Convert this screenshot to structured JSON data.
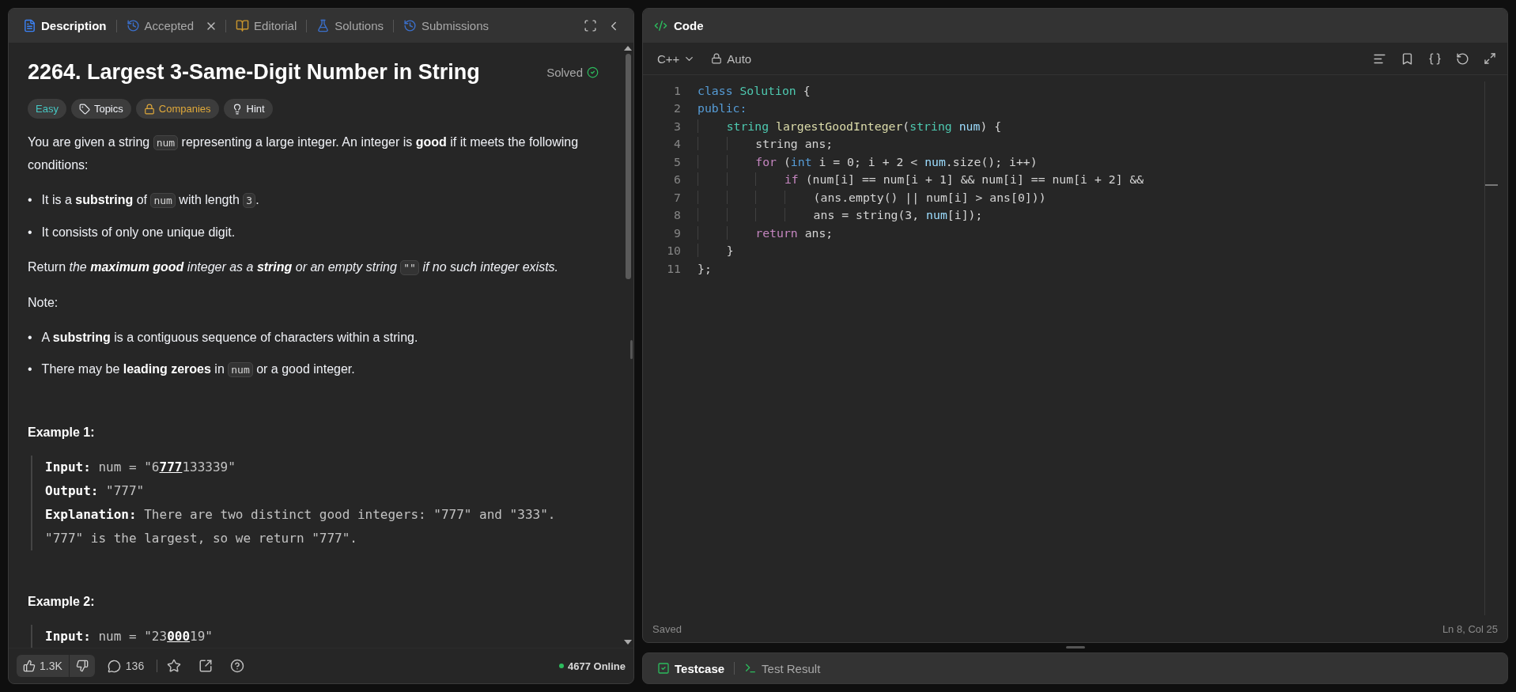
{
  "problem_panel": {
    "tabs": [
      {
        "label": "Description",
        "kind": "description",
        "selected": true,
        "closable": false
      },
      {
        "label": "Accepted",
        "kind": "history",
        "selected": false,
        "closable": true
      },
      {
        "label": "Editorial",
        "kind": "book",
        "selected": false,
        "closable": false
      },
      {
        "label": "Solutions",
        "kind": "flask",
        "selected": false,
        "closable": false
      },
      {
        "label": "Submissions",
        "kind": "history",
        "selected": false,
        "closable": false
      }
    ],
    "title": "2264. Largest 3-Same-Digit Number in String",
    "status": "Solved",
    "tags": [
      {
        "label": "Easy",
        "kind": "difficulty"
      },
      {
        "label": "Topics",
        "kind": "topics"
      },
      {
        "label": "Companies",
        "kind": "companies"
      },
      {
        "label": "Hint",
        "kind": "hint"
      }
    ],
    "content": [
      {
        "kind": "paragraph",
        "segments": [
          {
            "kind": "text",
            "text": "You are given a string "
          },
          {
            "kind": "code",
            "text": "num"
          },
          {
            "kind": "text",
            "text": " representing a large integer. An integer is **good** if it meets the following conditions:"
          }
        ]
      },
      {
        "kind": "bullets",
        "items": [
          {
            "marker": "•",
            "segments": [
              {
                "kind": "text",
                "text": "It is a **substring** of "
              },
              {
                "kind": "code",
                "text": "num"
              },
              {
                "kind": "text",
                "text": " with length "
              },
              {
                "kind": "code",
                "text": "3"
              },
              {
                "kind": "text",
                "text": "."
              }
            ]
          },
          {
            "marker": "•",
            "segments": [
              {
                "kind": "text",
                "text": "It consists of only one unique digit."
              }
            ]
          }
        ]
      },
      {
        "kind": "paragraph",
        "segments": [
          {
            "kind": "text",
            "text": "Return "
          },
          {
            "kind": "em",
            "text": "the **maximum good** integer as a **string** or an empty string "
          },
          {
            "kind": "code",
            "text": "\"\""
          },
          {
            "kind": "em",
            "text": " if no such integer exists."
          }
        ]
      },
      {
        "kind": "paragraph",
        "segments": [
          {
            "kind": "text",
            "text": "Note:"
          }
        ]
      },
      {
        "kind": "bullets",
        "items": [
          {
            "marker": "•",
            "segments": [
              {
                "kind": "text",
                "text": "A **substring** is a contiguous sequence of characters within a string."
              }
            ]
          },
          {
            "marker": "•",
            "segments": [
              {
                "kind": "text",
                "text": "There may be **leading zeroes** in "
              },
              {
                "kind": "code",
                "text": "num"
              },
              {
                "kind": "text",
                "text": " or a good integer."
              }
            ]
          }
        ]
      },
      {
        "kind": "example",
        "heading": "Example 1:",
        "lines": [
          {
            "label": "Input:",
            "segments": [
              {
                "kind": "text",
                "text": "num = \"6"
              },
              {
                "kind": "highlight",
                "text": "777"
              },
              {
                "kind": "text",
                "text": "133339\""
              }
            ]
          },
          {
            "label": "Output:",
            "segments": [
              {
                "kind": "text",
                "text": "\"777\""
              }
            ]
          },
          {
            "label": "Explanation:",
            "segments": [
              {
                "kind": "text",
                "text": "There are two distinct good integers: \"777\" and \"333\". \"777\" is the largest, so we return \"777\"."
              }
            ]
          }
        ]
      },
      {
        "kind": "example",
        "heading": "Example 2:",
        "lines": [
          {
            "label": "Input:",
            "segments": [
              {
                "kind": "text",
                "text": "num = \"23"
              },
              {
                "kind": "highlight",
                "text": "000"
              },
              {
                "kind": "text",
                "text": "19\""
              }
            ]
          }
        ]
      }
    ],
    "footer": {
      "likes": "1.3K",
      "comments": "136",
      "online": "4677 Online"
    }
  },
  "editor": {
    "title": "Code",
    "language": "C++",
    "mode": "Auto",
    "lines": [
      {
        "number": "1",
        "tokens": [
          {
            "kind": "keyword",
            "text": "class"
          },
          {
            "kind": "type",
            "text": " Solution"
          },
          {
            "kind": "plain",
            "text": " {"
          }
        ]
      },
      {
        "number": "2",
        "tokens": [
          {
            "kind": "keyword",
            "text": "public:"
          }
        ]
      },
      {
        "number": "3",
        "tokens": [
          {
            "kind": "type",
            "text": "    string"
          },
          {
            "kind": "function",
            "text": " largestGoodInteger"
          },
          {
            "kind": "plain",
            "text": "("
          },
          {
            "kind": "type",
            "text": "string"
          },
          {
            "kind": "variable",
            "text": " num"
          },
          {
            "kind": "plain",
            "text": ") {"
          }
        ]
      },
      {
        "number": "4",
        "tokens": [
          {
            "kind": "plain",
            "text": "        string ans;"
          }
        ]
      },
      {
        "number": "5",
        "tokens": [
          {
            "kind": "control",
            "text": "        for"
          },
          {
            "kind": "plain",
            "text": " ("
          },
          {
            "kind": "keyword",
            "text": "int"
          },
          {
            "kind": "plain",
            "text": " i = 0; i + 2 < "
          },
          {
            "kind": "variable",
            "text": "num"
          },
          {
            "kind": "plain",
            "text": ".size(); i++)"
          }
        ]
      },
      {
        "number": "6",
        "tokens": [
          {
            "kind": "control",
            "text": "            if"
          },
          {
            "kind": "plain",
            "text": " (num[i] == num[i + 1] && num[i] == num[i + 2] &&"
          }
        ]
      },
      {
        "number": "7",
        "tokens": [
          {
            "kind": "plain",
            "text": "                (ans.empty() || num[i] > ans[0]))"
          }
        ]
      },
      {
        "number": "8",
        "tokens": [
          {
            "kind": "plain",
            "text": "                ans = string(3, "
          },
          {
            "kind": "variable",
            "text": "num"
          },
          {
            "kind": "plain",
            "text": "[i]);"
          }
        ]
      },
      {
        "number": "9",
        "tokens": [
          {
            "kind": "control",
            "text": "        return"
          },
          {
            "kind": "plain",
            "text": " ans;"
          }
        ]
      },
      {
        "number": "10",
        "tokens": [
          {
            "kind": "plain",
            "text": "    }"
          }
        ]
      },
      {
        "number": "11",
        "tokens": [
          {
            "kind": "plain",
            "text": "};"
          }
        ]
      }
    ],
    "status": "Saved",
    "cursor": "Ln 8, Col 25"
  },
  "console": {
    "tabs": [
      {
        "label": "Testcase",
        "kind": "testcase",
        "selected": true
      },
      {
        "label": "Test Result",
        "kind": "result",
        "selected": false
      }
    ]
  }
}
